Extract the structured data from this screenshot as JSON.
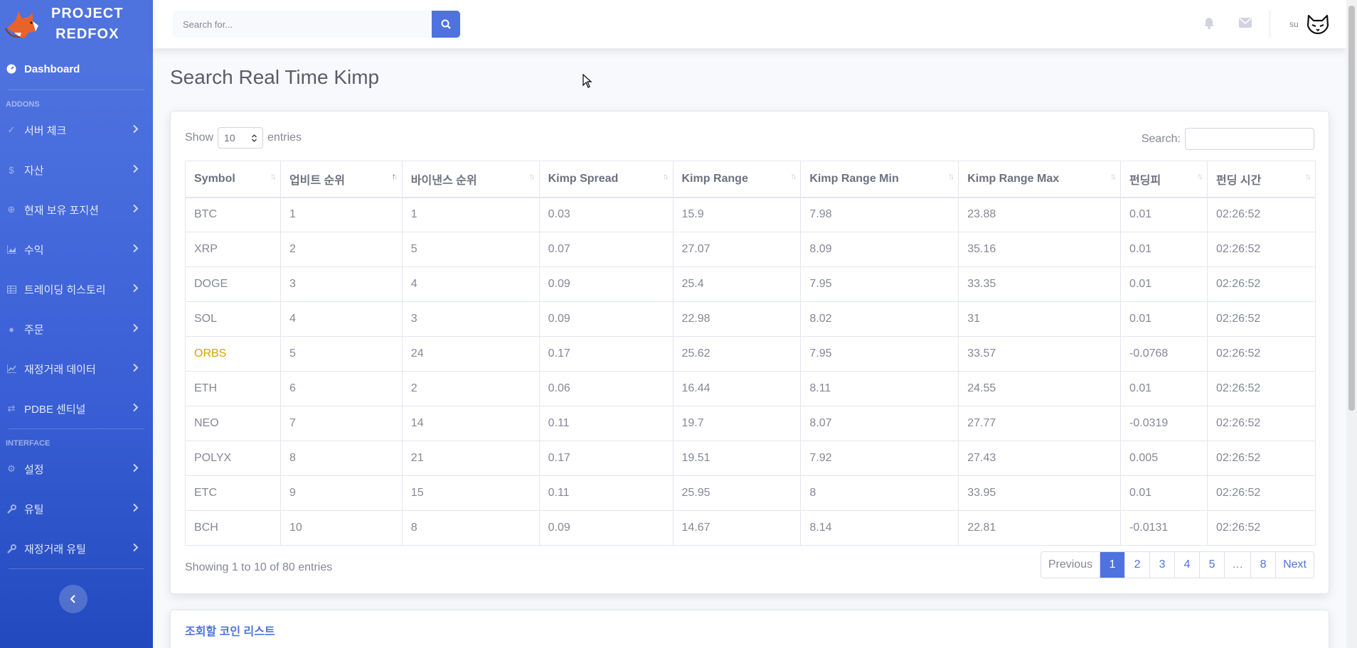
{
  "brand": {
    "line1": "PROJECT",
    "line2": "REDFOX"
  },
  "sidebar": {
    "dashboard": "Dashboard",
    "heading_addons": "ADDONS",
    "addons": [
      {
        "label": "서버 체크",
        "icon": "check-icon"
      },
      {
        "label": "자산",
        "icon": "dollar-icon"
      },
      {
        "label": "현재 보유 포지션",
        "icon": "crosshair-icon"
      },
      {
        "label": "수익",
        "icon": "chart-area-icon"
      },
      {
        "label": "트레이딩 히스토리",
        "icon": "table-icon"
      },
      {
        "label": "주문",
        "icon": "circle-icon"
      },
      {
        "label": "재정거래 데이터",
        "icon": "chart-line-icon"
      },
      {
        "label": "PDBE 센티널",
        "icon": "exchange-icon"
      }
    ],
    "heading_interface": "INTERFACE",
    "interface": [
      {
        "label": "설정",
        "icon": "gear-icon"
      },
      {
        "label": "유틸",
        "icon": "wrench-icon"
      },
      {
        "label": "재정거래 유틸",
        "icon": "wrench-icon"
      }
    ]
  },
  "topbar": {
    "search_placeholder": "Search for...",
    "user": "su"
  },
  "page": {
    "title": "Search Real Time Kimp"
  },
  "table_ctl": {
    "show": "Show",
    "entries_value": "10",
    "entries": "entries",
    "search_label": "Search:"
  },
  "table": {
    "headers": [
      "Symbol",
      "업비트 순위",
      "바이낸스 순위",
      "Kimp Spread",
      "Kimp Range",
      "Kimp Range Min",
      "Kimp Range Max",
      "펀딩피",
      "펀딩 시간"
    ],
    "rows": [
      [
        "BTC",
        "1",
        "1",
        "0.03",
        "15.9",
        "7.98",
        "23.88",
        "0.01",
        "02:26:52"
      ],
      [
        "XRP",
        "2",
        "5",
        "0.07",
        "27.07",
        "8.09",
        "35.16",
        "0.01",
        "02:26:52"
      ],
      [
        "DOGE",
        "3",
        "4",
        "0.09",
        "25.4",
        "7.95",
        "33.35",
        "0.01",
        "02:26:52"
      ],
      [
        "SOL",
        "4",
        "3",
        "0.09",
        "22.98",
        "8.02",
        "31",
        "0.01",
        "02:26:52"
      ],
      [
        "ORBS",
        "5",
        "24",
        "0.17",
        "25.62",
        "7.95",
        "33.57",
        "-0.0768",
        "02:26:52"
      ],
      [
        "ETH",
        "6",
        "2",
        "0.06",
        "16.44",
        "8.11",
        "24.55",
        "0.01",
        "02:26:52"
      ],
      [
        "NEO",
        "7",
        "14",
        "0.11",
        "19.7",
        "8.07",
        "27.77",
        "-0.0319",
        "02:26:52"
      ],
      [
        "POLYX",
        "8",
        "21",
        "0.17",
        "19.51",
        "7.92",
        "27.43",
        "0.005",
        "02:26:52"
      ],
      [
        "ETC",
        "9",
        "15",
        "0.11",
        "25.95",
        "8",
        "33.95",
        "0.01",
        "02:26:52"
      ],
      [
        "BCH",
        "10",
        "8",
        "0.09",
        "14.67",
        "8.14",
        "22.81",
        "-0.0131",
        "02:26:52"
      ]
    ]
  },
  "info": "Showing 1 to 10 of 80 entries",
  "pager": {
    "previous": "Previous",
    "pages": [
      "1",
      "2",
      "3",
      "4",
      "5",
      "…",
      "8"
    ],
    "next": "Next"
  },
  "card2": {
    "title": "조회할 코인 리스트"
  },
  "colors": {
    "primary": "#4e73df",
    "warning": "#d6a300"
  }
}
